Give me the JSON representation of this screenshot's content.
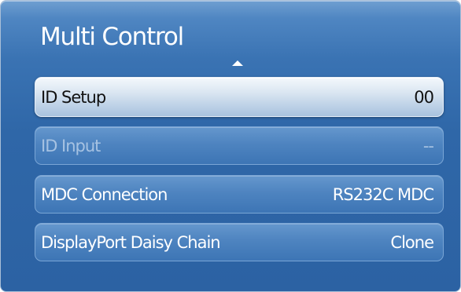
{
  "menu": {
    "title": "Multi Control",
    "items": [
      {
        "label": "ID Setup",
        "value": "00"
      },
      {
        "label": "ID Input",
        "value": "--"
      },
      {
        "label": "MDC Connection",
        "value": "RS232C MDC"
      },
      {
        "label": "DisplayPort Daisy Chain",
        "value": "Clone"
      }
    ]
  },
  "colors": {
    "panel_background": "#2f67a8",
    "item_background": "#4e84c0",
    "selected_item_background": "#d9e5f1",
    "disabled_text": "#a6c2e2"
  },
  "icons": {
    "scroll_up": "up-arrow-icon"
  }
}
